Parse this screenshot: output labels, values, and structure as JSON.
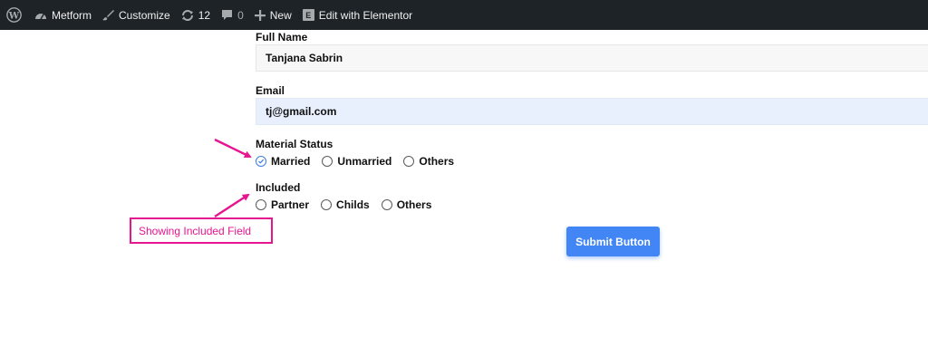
{
  "adminbar": {
    "site_name": "Metform",
    "customize_label": "Customize",
    "updates_count": "12",
    "comments_count": "0",
    "new_label": "New",
    "elementor_icon_letter": "E",
    "elementor_label": "Edit with Elementor",
    "icons": [
      "wordpress-logo-icon",
      "dashboard-icon",
      "brush-icon",
      "refresh-icon",
      "comment-icon",
      "plus-icon",
      "elementor-icon"
    ]
  },
  "form": {
    "full_name_label": "Full Name",
    "full_name_value": "Tanjana Sabrin",
    "email_label": "Email",
    "email_value": "tj@gmail.com",
    "status_label": "Material Status",
    "status_options": [
      {
        "label": "Married",
        "checked": true
      },
      {
        "label": "Unmarried",
        "checked": false
      },
      {
        "label": "Others",
        "checked": false
      }
    ],
    "included_label": "Included",
    "included_options": [
      {
        "label": "Partner",
        "checked": false
      },
      {
        "label": "Childs",
        "checked": false
      },
      {
        "label": "Others",
        "checked": false
      }
    ],
    "submit_label": "Submit Button"
  },
  "annotation": {
    "text": "Showing Included Field",
    "color": "#e5168f"
  },
  "colors": {
    "adminbar_bg": "#1d2327",
    "submit_bg": "#4285f4",
    "email_bg": "#e8f0fe"
  }
}
